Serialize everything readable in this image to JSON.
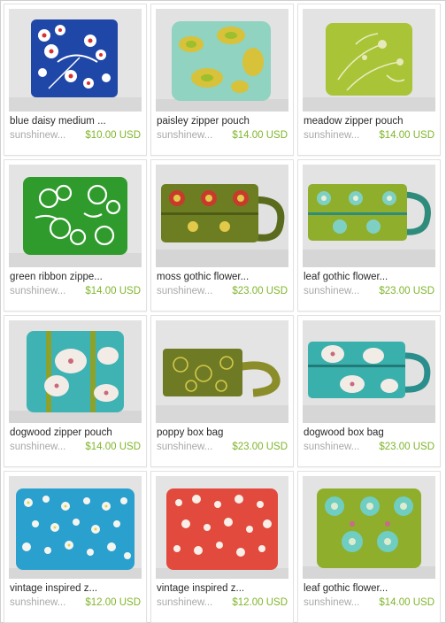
{
  "listings": [
    {
      "title": "blue daisy medium ...",
      "shop": "sunshinew...",
      "price": "$10.00 USD",
      "image": "blue-daisy-pouch"
    },
    {
      "title": "paisley zipper pouch",
      "shop": "sunshinew...",
      "price": "$14.00 USD",
      "image": "paisley-pouch"
    },
    {
      "title": "meadow zipper pouch",
      "shop": "sunshinew...",
      "price": "$14.00 USD",
      "image": "meadow-pouch"
    },
    {
      "title": "green ribbon zippe...",
      "shop": "sunshinew...",
      "price": "$14.00 USD",
      "image": "green-ribbon-pouch"
    },
    {
      "title": "moss gothic flower...",
      "shop": "sunshinew...",
      "price": "$23.00 USD",
      "image": "moss-gothic-box-bag"
    },
    {
      "title": "leaf gothic flower...",
      "shop": "sunshinew...",
      "price": "$23.00 USD",
      "image": "leaf-gothic-box-bag"
    },
    {
      "title": "dogwood zipper pouch",
      "shop": "sunshinew...",
      "price": "$14.00 USD",
      "image": "dogwood-pouch"
    },
    {
      "title": "poppy box bag",
      "shop": "sunshinew...",
      "price": "$23.00 USD",
      "image": "poppy-box-bag"
    },
    {
      "title": "dogwood box bag",
      "shop": "sunshinew...",
      "price": "$23.00 USD",
      "image": "dogwood-box-bag"
    },
    {
      "title": "vintage inspired z...",
      "shop": "sunshinew...",
      "price": "$12.00 USD",
      "image": "vintage-blue-pouch"
    },
    {
      "title": "vintage inspired z...",
      "shop": "sunshinew...",
      "price": "$12.00 USD",
      "image": "vintage-red-pouch"
    },
    {
      "title": "leaf gothic flower...",
      "shop": "sunshinew...",
      "price": "$14.00 USD",
      "image": "leaf-gothic-pouch"
    }
  ],
  "colors": {
    "price": "#7fb52a",
    "shop": "#a9a9a9",
    "title": "#2a2a2a"
  }
}
